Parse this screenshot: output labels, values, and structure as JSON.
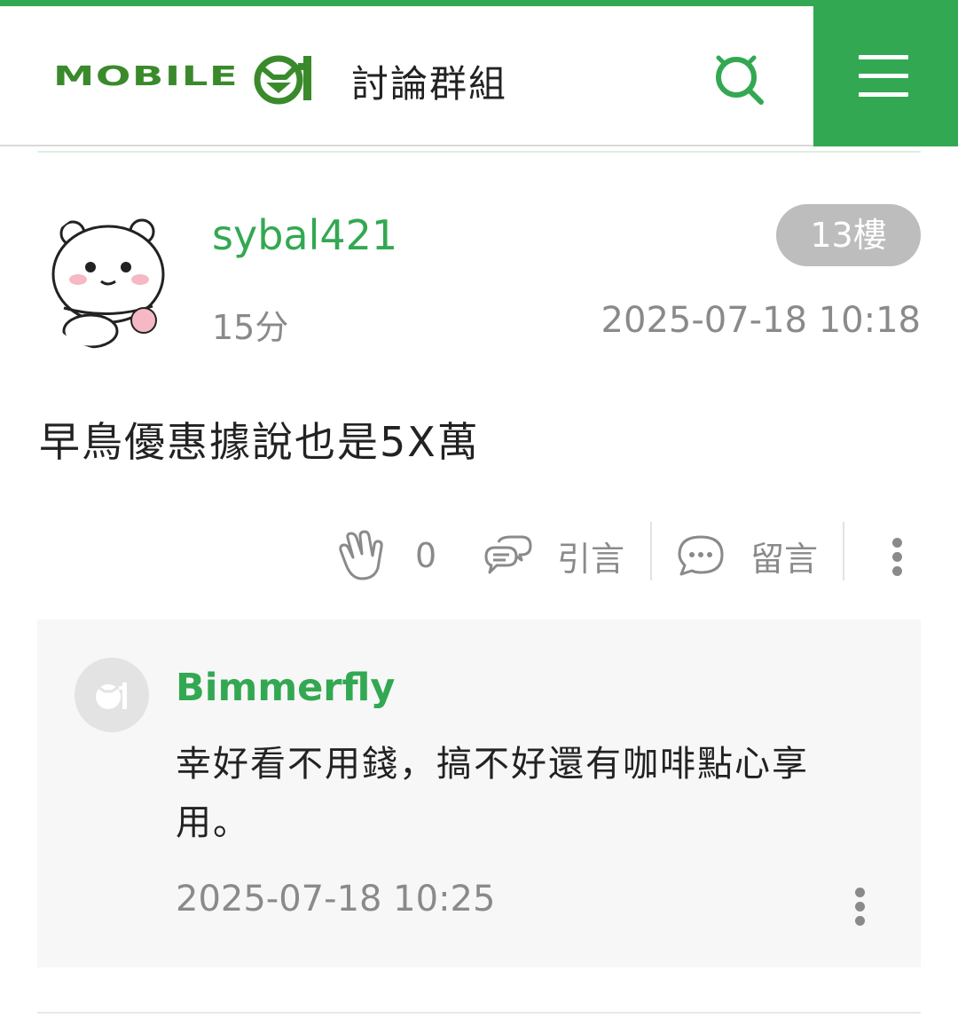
{
  "header": {
    "logo_text": "MOBILE",
    "title": "討論群組",
    "search_icon": "search-icon",
    "menu_icon": "hamburger-menu-icon"
  },
  "colors": {
    "brand_green": "#33a852",
    "muted_gray": "#8a8a8a",
    "badge_gray": "#bdbdbd",
    "reply_bg": "#f7f7f7"
  },
  "post": {
    "username": "sybal421",
    "score": "15分",
    "floor": "13樓",
    "timestamp": "2025-07-18 10:18",
    "body": "早鳥優惠據說也是5X萬",
    "actions": {
      "like_count": "0",
      "quote_label": "引言",
      "comment_label": "留言"
    }
  },
  "reply": {
    "username": "Bimmerfly",
    "text": "幸好看不用錢，搞不好還有咖啡點心享用。",
    "timestamp": "2025-07-18 10:25"
  }
}
